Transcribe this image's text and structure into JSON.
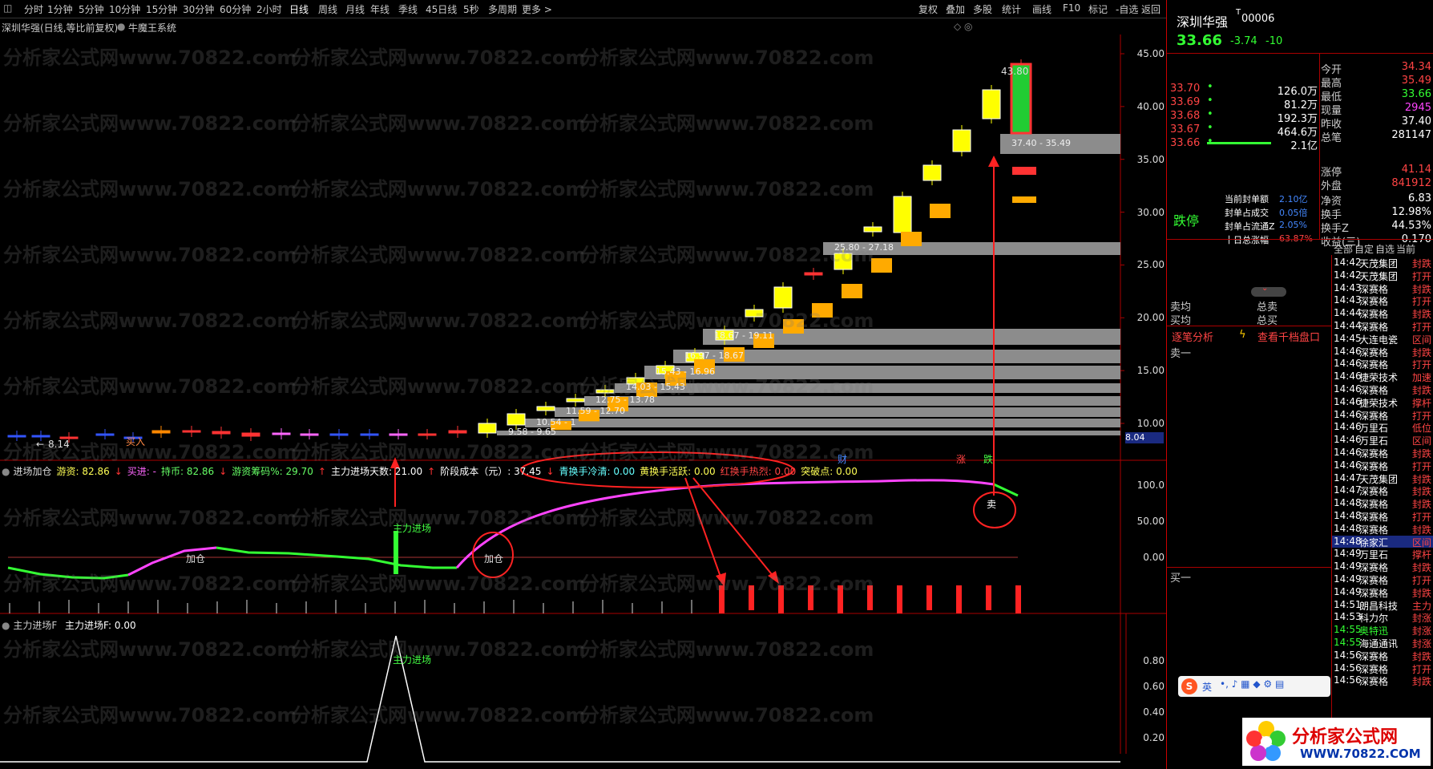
{
  "toolbar": {
    "period_tabs": [
      "分时",
      "1分钟",
      "5分钟",
      "10分钟",
      "15分钟",
      "30分钟",
      "60分钟",
      "2小时",
      "日线",
      "周线",
      "月线",
      "年线",
      "季线",
      "45日线",
      "5秒",
      "多周期",
      "更多 >"
    ],
    "right_buttons": [
      "复权",
      "叠加",
      "多股",
      "统计",
      "画线",
      "F10",
      "标记",
      "-自选",
      "返回"
    ]
  },
  "chart_title": {
    "stock": "深圳华强(日线,等比前复权)",
    "formula": "牛魔王系统"
  },
  "watermark_text": "分析家公式网www.70822.com",
  "main_chart": {
    "price_axis": [
      "45.00",
      "40.00",
      "35.00",
      "30.00",
      "25.00",
      "20.00",
      "15.00",
      "10.00"
    ],
    "current_price_tag": "8.04",
    "high_label": "43.80",
    "low_label": "8.14",
    "buy_label": "买入",
    "zones": [
      "37.40 - 35.49",
      "25.80 - 27.18",
      "18.67 - 19.11",
      "16.97 - 18.67",
      "15.43 - 16.96",
      "14.03 - 15.43",
      "12.75 - 13.78",
      "11.59 - 12.70",
      "10.54 - 1",
      "9.58 - 9.65"
    ],
    "markers": {
      "cai": "财",
      "zhang": "涨",
      "die": "跌"
    }
  },
  "indicator": {
    "name": "进场加仓",
    "values": [
      {
        "label": "游资: 82.86",
        "color": "#ffff55"
      },
      {
        "label": "↓",
        "color": "#ff3333"
      },
      {
        "label": "买进: -",
        "color": "#ff66ff"
      },
      {
        "label": "持币: 82.86",
        "color": "#66ff66"
      },
      {
        "label": "↓",
        "color": "#ff3333"
      },
      {
        "label": "游资筹码%: 29.70",
        "color": "#66ff66"
      },
      {
        "label": "↑",
        "color": "#ff3333"
      },
      {
        "label": "主力进场天数: 21.00",
        "color": "#ffffff"
      },
      {
        "label": "↑",
        "color": "#ff3333"
      },
      {
        "label": "阶段成本（元）: 37.45",
        "color": "#ffffff"
      },
      {
        "label": "↓",
        "color": "#ff3333"
      },
      {
        "label": "青换手冷清: 0.00",
        "color": "#66ffff"
      },
      {
        "label": "黄换手活跃: 0.00",
        "color": "#ffff55"
      },
      {
        "label": "红换手热烈: 0.00",
        "color": "#ff4444"
      },
      {
        "label": "突破点: 0.00",
        "color": "#ffff55"
      }
    ],
    "axis": [
      "100.0",
      "50.00",
      "0.00"
    ],
    "labels": {
      "jiacang1": "加仓",
      "jiacang2": "加仓",
      "zhuli": "主力进场",
      "sell": "卖"
    }
  },
  "indicator2": {
    "name": "主力进场F",
    "value": "主力进场F: 0.00",
    "axis": [
      "0.80",
      "0.60",
      "0.40",
      "0.20"
    ],
    "label": "主力进场"
  },
  "quote": {
    "name": "深圳华强",
    "code": "00006",
    "price": "33.66",
    "change": "-3.74",
    "pct": "-10",
    "stats": [
      {
        "k": "今开",
        "v": "34.34",
        "c": "#ff4444"
      },
      {
        "k": "最高",
        "v": "35.49",
        "c": "#ff4444"
      },
      {
        "k": "最低",
        "v": "33.66",
        "c": "#33ff33"
      },
      {
        "k": "现量",
        "v": "2945",
        "c": "#ff44ff"
      },
      {
        "k": "昨收",
        "v": "37.40",
        "c": "#ffffff"
      },
      {
        "k": "总笔",
        "v": "281147",
        "c": "#ffffff"
      },
      {
        "k": "涨停",
        "v": "41.14",
        "c": "#ff4444"
      },
      {
        "k": "外盘",
        "v": "841912",
        "c": "#ff4444"
      },
      {
        "k": "净资",
        "v": "6.83",
        "c": "#ffffff"
      },
      {
        "k": "换手",
        "v": "12.98%",
        "c": "#ffffff"
      },
      {
        "k": "换手Z",
        "v": "44.53%",
        "c": "#ffffff"
      },
      {
        "k": "收益(三)",
        "v": "0.170",
        "c": "#ffffff"
      }
    ],
    "bids": [
      {
        "p": "33.70",
        "v": "126.0万"
      },
      {
        "p": "33.69",
        "v": "81.2万"
      },
      {
        "p": "33.68",
        "v": "192.3万"
      },
      {
        "p": "33.67",
        "v": "464.6万"
      },
      {
        "p": "33.66",
        "v": "2.1亿"
      }
    ],
    "limit_label": "跌停",
    "seal": [
      {
        "k": "当前封单额",
        "v": "2.10亿"
      },
      {
        "k": "封单占成交",
        "v": "0.05倍"
      },
      {
        "k": "封单占流通Z",
        "v": "2.05%"
      },
      {
        "k": "十日总涨幅",
        "v": "63.87%"
      }
    ],
    "tabs": [
      "全部",
      "自定",
      "自选",
      "当前"
    ],
    "avg": {
      "sell_avg": "卖均",
      "total_sell": "总卖",
      "buy_avg": "买均",
      "total_buy": "总买"
    },
    "links": {
      "tick": "逐笔分析",
      "level": "查看千档盘口"
    },
    "sell1": "卖一",
    "buy1": "买一"
  },
  "news": [
    {
      "t": "14:42",
      "n": "天茂集团",
      "s": "封跌"
    },
    {
      "t": "14:42",
      "n": "天茂集团",
      "s": "打开"
    },
    {
      "t": "14:43",
      "n": "深赛格",
      "s": "封跌"
    },
    {
      "t": "14:43",
      "n": "深赛格",
      "s": "打开"
    },
    {
      "t": "14:44",
      "n": "深赛格",
      "s": "封跌"
    },
    {
      "t": "14:44",
      "n": "深赛格",
      "s": "打开"
    },
    {
      "t": "14:45",
      "n": "大连电瓷",
      "s": "区间"
    },
    {
      "t": "14:46",
      "n": "深赛格",
      "s": "封跌"
    },
    {
      "t": "14:46",
      "n": "深赛格",
      "s": "打开"
    },
    {
      "t": "14:46",
      "n": "捷荣技术",
      "s": "加速"
    },
    {
      "t": "14:46",
      "n": "深赛格",
      "s": "封跌"
    },
    {
      "t": "14:46",
      "n": "捷荣技术",
      "s": "撑杆"
    },
    {
      "t": "14:46",
      "n": "深赛格",
      "s": "打开"
    },
    {
      "t": "14:46",
      "n": "万里石",
      "s": "低位"
    },
    {
      "t": "14:46",
      "n": "万里石",
      "s": "区间"
    },
    {
      "t": "14:46",
      "n": "深赛格",
      "s": "封跌"
    },
    {
      "t": "14:46",
      "n": "深赛格",
      "s": "打开"
    },
    {
      "t": "14:47",
      "n": "天茂集团",
      "s": "封跌"
    },
    {
      "t": "14:47",
      "n": "深赛格",
      "s": "封跌"
    },
    {
      "t": "14:48",
      "n": "深赛格",
      "s": "封跌"
    },
    {
      "t": "14:48",
      "n": "深赛格",
      "s": "打开"
    },
    {
      "t": "14:48",
      "n": "深赛格",
      "s": "封跌"
    },
    {
      "t": "14:48",
      "n": "徐家汇",
      "s": "区间"
    },
    {
      "t": "14:49",
      "n": "万里石",
      "s": "撑杆"
    },
    {
      "t": "14:49",
      "n": "深赛格",
      "s": "封跌"
    },
    {
      "t": "14:49",
      "n": "深赛格",
      "s": "打开"
    },
    {
      "t": "14:49",
      "n": "深赛格",
      "s": "封跌"
    },
    {
      "t": "14:51",
      "n": "朗昌科技",
      "s": "主力"
    },
    {
      "t": "14:53",
      "n": "科力尔",
      "s": "封涨"
    },
    {
      "t": "14:55",
      "n": "奥特迅",
      "s": "封涨"
    },
    {
      "t": "14:55",
      "n": "海通通讯",
      "s": "封涨"
    },
    {
      "t": "14:56",
      "n": "深赛格",
      "s": "封跌"
    },
    {
      "t": "14:56",
      "n": "深赛格",
      "s": "打开"
    },
    {
      "t": "14:56",
      "n": "深赛格",
      "s": "封跌"
    }
  ],
  "ime": {
    "label": "英"
  },
  "logo": {
    "title": "分析家公式网",
    "url": "WWW.70822.COM"
  }
}
